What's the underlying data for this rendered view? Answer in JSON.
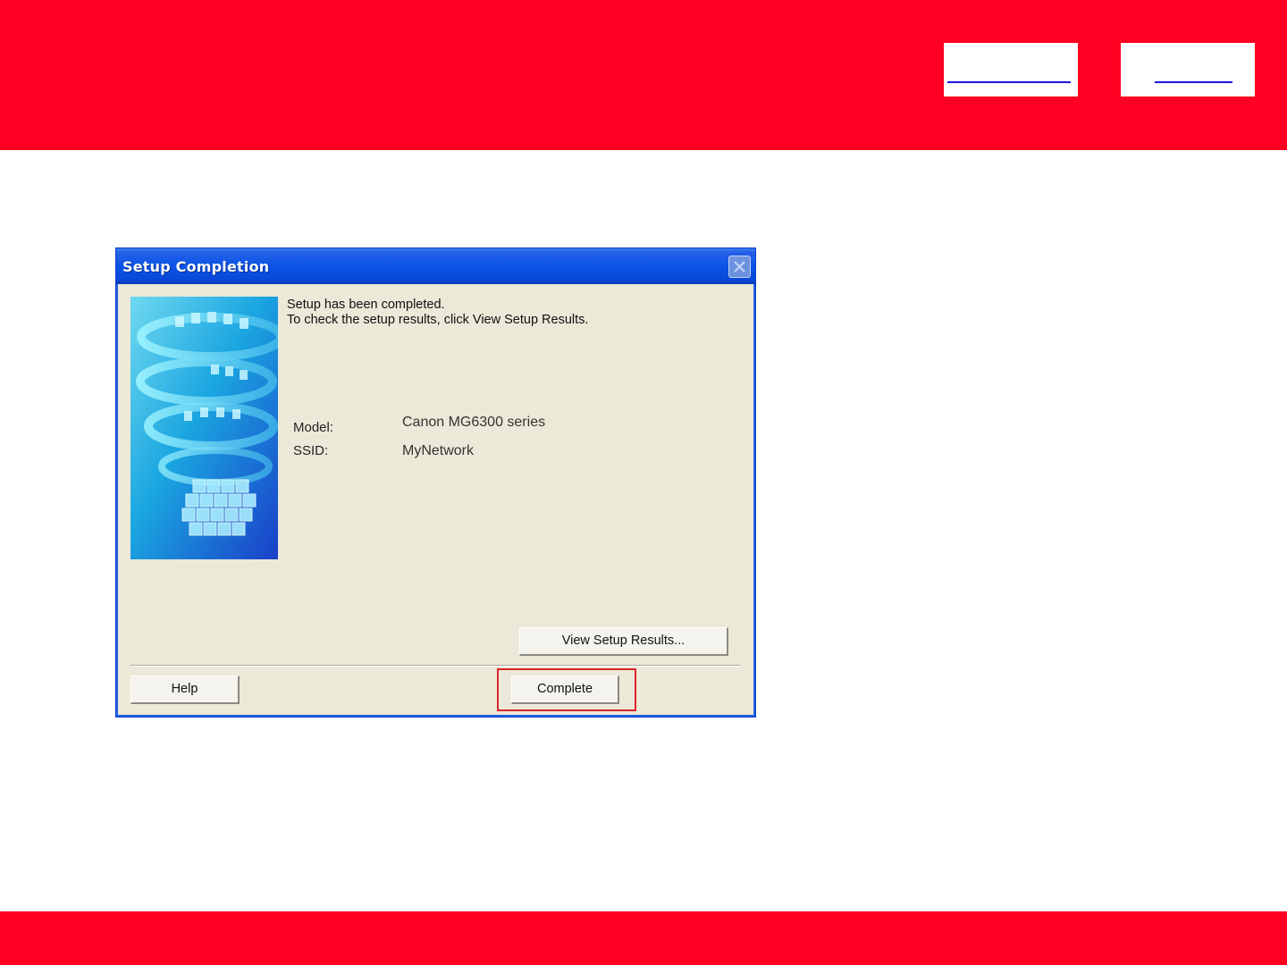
{
  "page": {
    "colors": {
      "banner": "#ff0022",
      "link": "#1a1adb",
      "highlight": "#d9262a"
    }
  },
  "dialog": {
    "title": "Setup Completion",
    "message_line1": "Setup has been completed.",
    "message_line2": "To check the setup results, click View Setup Results.",
    "model_label": "Model:",
    "model_value": "Canon MG6300 series",
    "ssid_label": "SSID:",
    "ssid_value": "MyNetwork",
    "view_results_label": "View Setup Results...",
    "help_label": "Help",
    "complete_label": "Complete",
    "close_icon": "close-icon"
  }
}
